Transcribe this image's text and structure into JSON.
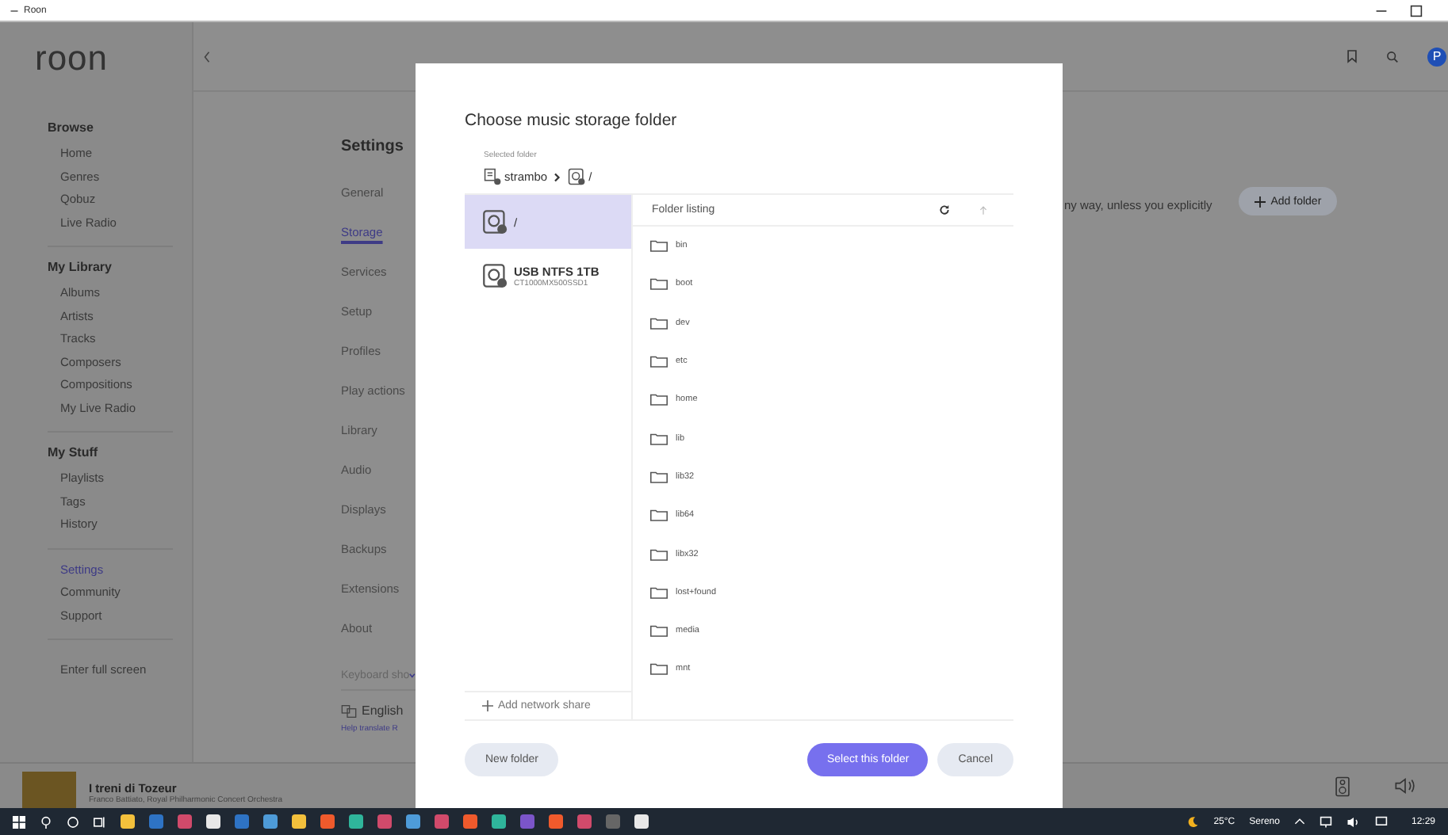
{
  "window": {
    "title": "Roon"
  },
  "sidebar": {
    "logo": "roon",
    "sections": [
      {
        "heading": "Browse",
        "items": [
          {
            "label": "Home",
            "selected": false
          },
          {
            "label": "Genres",
            "selected": false
          },
          {
            "label": "Qobuz",
            "selected": false
          },
          {
            "label": "Live Radio",
            "selected": false
          }
        ]
      },
      {
        "heading": "My Library",
        "items": [
          {
            "label": "Albums",
            "selected": false
          },
          {
            "label": "Artists",
            "selected": false
          },
          {
            "label": "Tracks",
            "selected": false
          },
          {
            "label": "Composers",
            "selected": false
          },
          {
            "label": "Compositions",
            "selected": false
          },
          {
            "label": "My Live Radio",
            "selected": false
          }
        ]
      },
      {
        "heading": "My Stuff",
        "items": [
          {
            "label": "Playlists",
            "selected": false
          },
          {
            "label": "Tags",
            "selected": false
          },
          {
            "label": "History",
            "selected": false
          }
        ]
      },
      {
        "items": [
          {
            "label": "Settings",
            "selected": true
          },
          {
            "label": "Community",
            "selected": false
          },
          {
            "label": "Support",
            "selected": false
          }
        ]
      }
    ],
    "footer": "Enter full screen"
  },
  "topbar": {
    "avatar": "P"
  },
  "settings": {
    "heading": "Settings",
    "nav": [
      {
        "label": "General",
        "selected": false
      },
      {
        "label": "Storage",
        "selected": true
      },
      {
        "label": "Services",
        "selected": false
      },
      {
        "label": "Setup",
        "selected": false
      },
      {
        "label": "Profiles",
        "selected": false
      },
      {
        "label": "Play actions",
        "selected": false
      },
      {
        "label": "Library",
        "selected": false
      },
      {
        "label": "Audio",
        "selected": false
      },
      {
        "label": "Displays",
        "selected": false
      },
      {
        "label": "Backups",
        "selected": false
      },
      {
        "label": "Extensions",
        "selected": false
      },
      {
        "label": "About",
        "selected": false
      }
    ],
    "shortcuts": "Keyboard sho",
    "language": "English",
    "help": "Help translate R"
  },
  "storage": {
    "text": "ny way, unless you explicitly",
    "add_button": "Add folder"
  },
  "modal": {
    "title": "Choose music storage folder",
    "selected_label": "Selected folder",
    "path": [
      {
        "kind": "host",
        "label": "strambo"
      },
      {
        "kind": "drive",
        "label": "/"
      }
    ],
    "drives": [
      {
        "name": "/",
        "selected": true
      },
      {
        "name": "USB NTFS 1TB",
        "detail": "CT1000MX500SSD1",
        "selected": false
      }
    ],
    "add_share": "Add network share",
    "listing_header": "Folder listing",
    "folders": [
      "bin",
      "boot",
      "dev",
      "etc",
      "home",
      "lib",
      "lib32",
      "lib64",
      "libx32",
      "lost+found",
      "media",
      "mnt"
    ],
    "buttons": [
      {
        "kind": "secondary",
        "label": "New folder"
      },
      {
        "kind": "primary",
        "label": "Select this folder"
      },
      {
        "kind": "secondary",
        "label": "Cancel"
      }
    ]
  },
  "now_playing": {
    "title": "I treni di Tozeur",
    "artist": "Franco Battiato, Royal Philharmonic Concert Orchestra"
  },
  "taskbar": {
    "weather": "25°C",
    "condition": "Sereno",
    "time": "12:29"
  }
}
